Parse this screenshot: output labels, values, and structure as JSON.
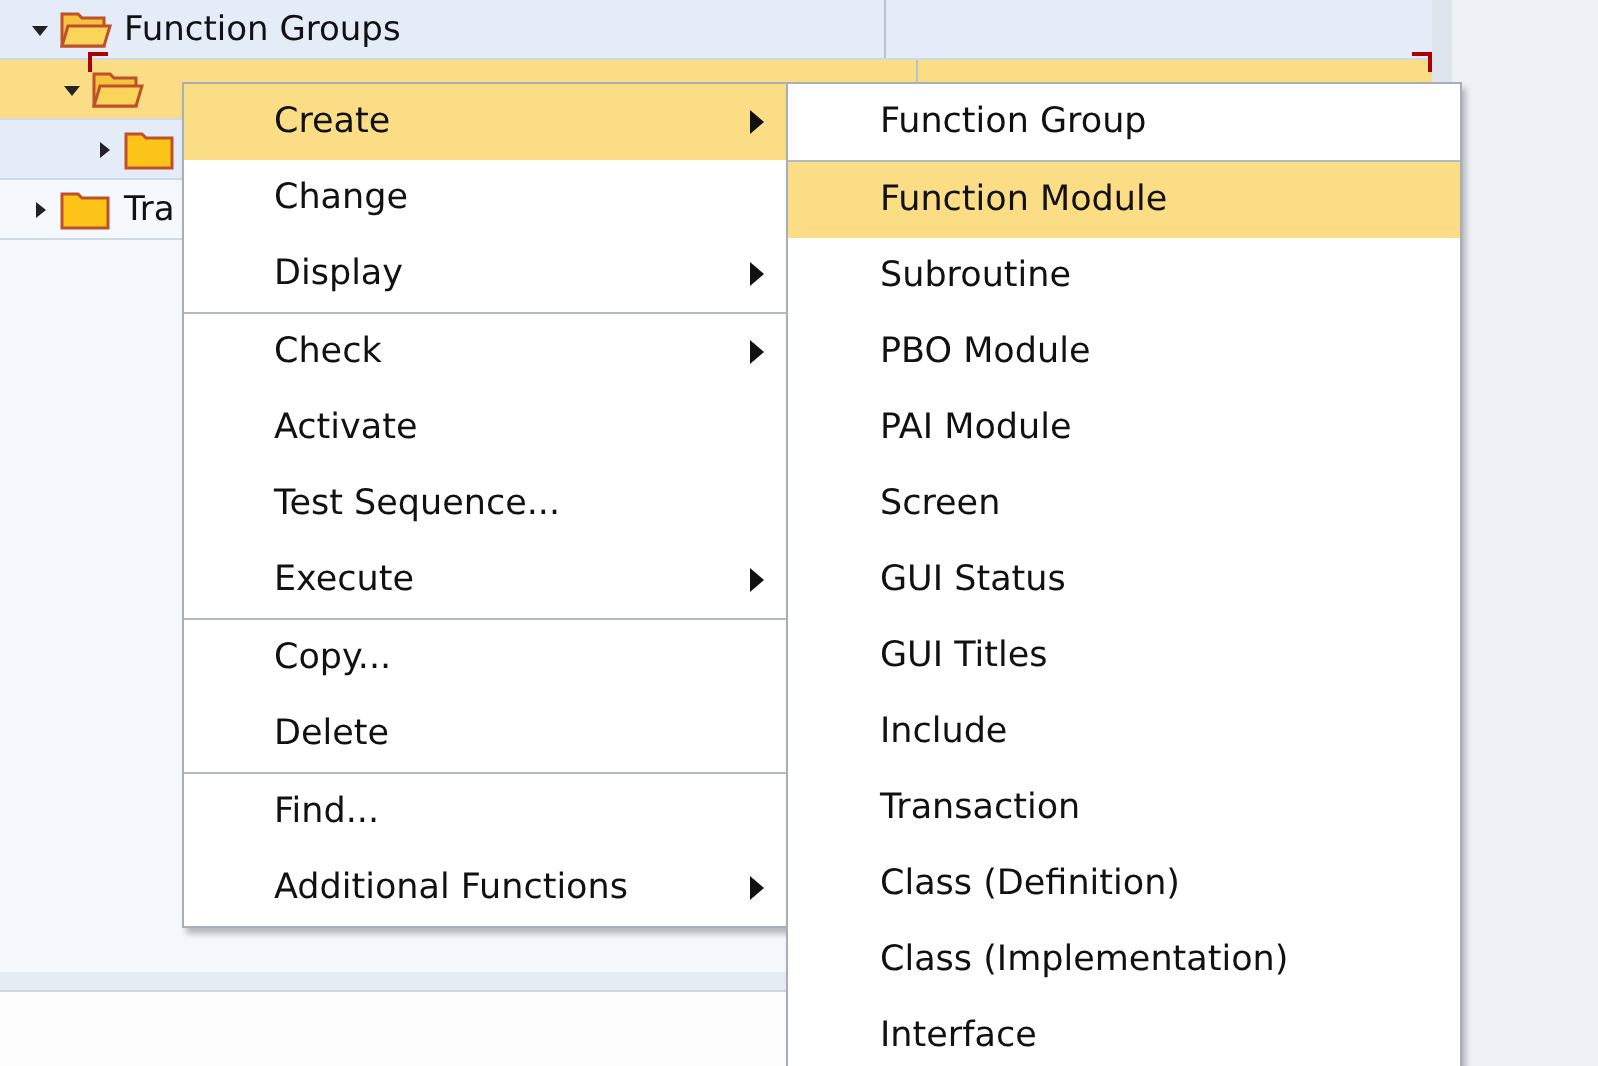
{
  "tree": {
    "items": [
      {
        "label": "Function Groups",
        "expanded": true,
        "open": true,
        "selected": false
      },
      {
        "expanded": true,
        "open": true,
        "selected": true
      },
      {
        "expanded": false,
        "open": false,
        "selected": false
      },
      {
        "label": "Tra",
        "expanded": false,
        "open": false,
        "selected": false
      }
    ]
  },
  "context_menu": {
    "items": [
      {
        "kind": "item",
        "label": "Create",
        "submenu": true,
        "selected": true
      },
      {
        "kind": "item",
        "label": "Change",
        "submenu": false,
        "selected": false
      },
      {
        "kind": "item",
        "label": "Display",
        "submenu": true,
        "selected": false
      },
      {
        "kind": "separator"
      },
      {
        "kind": "item",
        "label": "Check",
        "submenu": true,
        "selected": false
      },
      {
        "kind": "item",
        "label": "Activate",
        "submenu": false,
        "selected": false
      },
      {
        "kind": "item",
        "label": "Test Sequence...",
        "submenu": false,
        "selected": false
      },
      {
        "kind": "item",
        "label": "Execute",
        "submenu": true,
        "selected": false
      },
      {
        "kind": "separator"
      },
      {
        "kind": "item",
        "label": "Copy...",
        "submenu": false,
        "selected": false
      },
      {
        "kind": "item",
        "label": "Delete",
        "submenu": false,
        "selected": false
      },
      {
        "kind": "separator"
      },
      {
        "kind": "item",
        "label": "Find...",
        "submenu": false,
        "selected": false
      },
      {
        "kind": "item",
        "label": "Additional Functions",
        "submenu": true,
        "selected": false
      }
    ]
  },
  "submenu": {
    "items": [
      {
        "kind": "item",
        "label": "Function Group",
        "selected": false
      },
      {
        "kind": "separator"
      },
      {
        "kind": "item",
        "label": "Function Module",
        "selected": true
      },
      {
        "kind": "item",
        "label": "Subroutine",
        "selected": false
      },
      {
        "kind": "item",
        "label": "PBO Module",
        "selected": false
      },
      {
        "kind": "item",
        "label": "PAI Module",
        "selected": false
      },
      {
        "kind": "item",
        "label": "Screen",
        "selected": false
      },
      {
        "kind": "item",
        "label": "GUI Status",
        "selected": false
      },
      {
        "kind": "item",
        "label": "GUI Titles",
        "selected": false
      },
      {
        "kind": "item",
        "label": "Include",
        "selected": false
      },
      {
        "kind": "item",
        "label": "Transaction",
        "selected": false
      },
      {
        "kind": "item",
        "label": "Class (Definition)",
        "selected": false
      },
      {
        "kind": "item",
        "label": "Class (Implementation)",
        "selected": false
      },
      {
        "kind": "item",
        "label": "Interface",
        "selected": false
      }
    ]
  }
}
